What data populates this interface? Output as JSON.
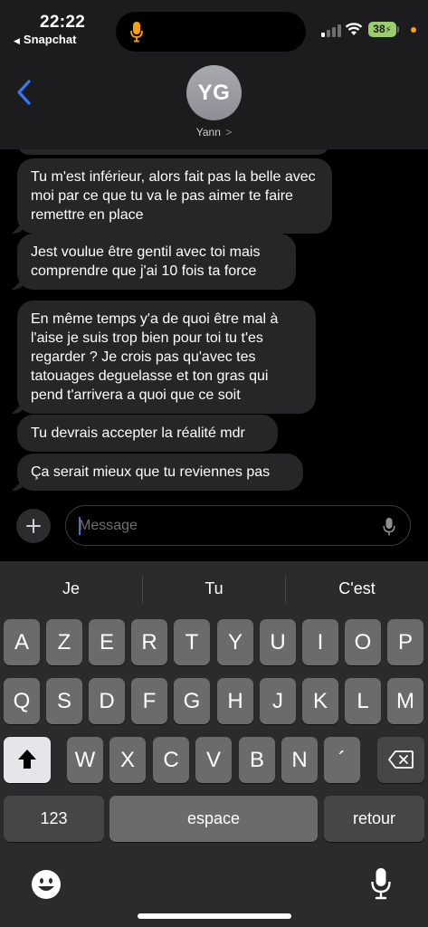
{
  "status_bar": {
    "time": "22:22",
    "back_app": "Snapchat",
    "battery": "38"
  },
  "header": {
    "avatar_initials": "YG",
    "contact_name": "Yann",
    "contact_chevron": ">"
  },
  "messages": [
    {
      "text": "Tu m'est inférieur, alors fait pas la belle avec moi par ce que tu va le pas aimer te faire remettre en place"
    },
    {
      "text": "Jest voulue être gentil avec toi mais comprendre que j'ai 10 fois ta force"
    },
    {
      "text": "En même temps y'a de quoi être mal à l'aise je suis trop bien pour toi tu t'es regarder ? Je crois pas qu'avec tes tatouages deguelasse et ton gras qui pend t'arrivera a quoi que ce soit"
    },
    {
      "text": "Tu devrais accepter la réalité mdr"
    },
    {
      "text": "Ça serait mieux que tu reviennes pas"
    }
  ],
  "composer": {
    "placeholder": "Message",
    "value": ""
  },
  "keyboard": {
    "suggestions": [
      "Je",
      "Tu",
      "C'est"
    ],
    "row1": [
      "A",
      "Z",
      "E",
      "R",
      "T",
      "Y",
      "U",
      "I",
      "O",
      "P"
    ],
    "row2": [
      "Q",
      "S",
      "D",
      "F",
      "G",
      "H",
      "J",
      "K",
      "L",
      "M"
    ],
    "row3": [
      "W",
      "X",
      "C",
      "V",
      "B",
      "N",
      "´"
    ],
    "numbers_label": "123",
    "space_label": "espace",
    "return_label": "retour"
  },
  "colors": {
    "accent_blue": "#3478f6",
    "bubble_bg": "#262628",
    "mic_orange": "#ff9f0a",
    "battery_green": "#9acd6b"
  }
}
